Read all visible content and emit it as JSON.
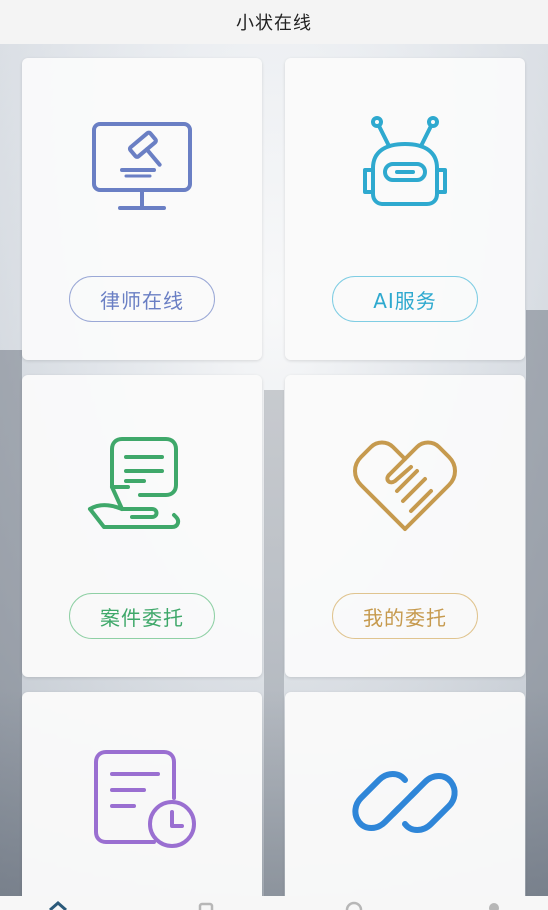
{
  "app": {
    "title": "小状在线"
  },
  "cards": [
    {
      "label": "律师在线",
      "icon": "gavel-monitor-icon",
      "color": "#6a7fc4"
    },
    {
      "label": "AI服务",
      "icon": "robot-icon",
      "color": "#2ea9cf"
    },
    {
      "label": "案件委托",
      "icon": "hand-document-icon",
      "color": "#3fa86a"
    },
    {
      "label": "我的委托",
      "icon": "handshake-icon",
      "color": "#c69a4e"
    },
    {
      "label": "",
      "icon": "document-clock-icon",
      "color": "#9a6fd1"
    },
    {
      "label": "",
      "icon": "link-icon",
      "color": "#2f86d8"
    }
  ],
  "tabbar": {
    "tabs": [
      {
        "icon": "home-icon",
        "active": true
      },
      {
        "icon": "document-tab-icon",
        "active": false
      },
      {
        "icon": "message-tab-icon",
        "active": false
      },
      {
        "icon": "profile-tab-icon",
        "active": false
      }
    ]
  }
}
